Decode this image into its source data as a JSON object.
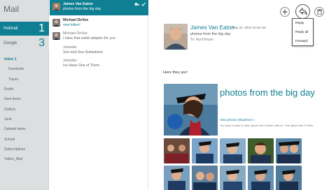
{
  "app": {
    "title": "Mail"
  },
  "accounts": [
    {
      "name": "Hotmail",
      "count": "1",
      "selected": true
    },
    {
      "name": "Google",
      "count": "3",
      "selected": false
    }
  ],
  "folders": [
    {
      "label": "Inbox 1",
      "active": true,
      "sub": false
    },
    {
      "label": "Facebook",
      "active": false,
      "sub": true
    },
    {
      "label": "Travel",
      "active": false,
      "sub": true
    },
    {
      "label": "Drafts",
      "active": false,
      "sub": false
    },
    {
      "label": "Sent items",
      "active": false,
      "sub": false
    },
    {
      "label": "Outbox",
      "active": false,
      "sub": false
    },
    {
      "label": "Junk",
      "active": false,
      "sub": false
    },
    {
      "label": "Deleted items",
      "active": false,
      "sub": false
    },
    {
      "label": "School",
      "active": false,
      "sub": false
    },
    {
      "label": "Subscriptions",
      "active": false,
      "sub": false
    },
    {
      "label": "Yahoo_Mail",
      "active": false,
      "sub": false
    }
  ],
  "messages": [
    {
      "from": "James Van Eaton",
      "subject": "photos from the big day",
      "selected": true,
      "new": false,
      "avatar": "#8a6a52"
    },
    {
      "from": "Michael DeVoe",
      "subject": "new kitten!",
      "selected": false,
      "new": true,
      "avatar": "#6d6d6d"
    },
    {
      "from": "Michael DeVoe",
      "subject": "I have that outlet adapter for you",
      "selected": false,
      "new": false,
      "avatar": "#6d6d6d"
    },
    {
      "from": "Jetsetter",
      "subject": "Sun and Sea Subsations",
      "selected": false,
      "new": false,
      "avatar": null
    },
    {
      "from": "Jetsetter",
      "subject": "Ice Have One of Them",
      "selected": false,
      "new": false,
      "avatar": null
    }
  ],
  "reading": {
    "sender": "James Van Eaton",
    "date": "May 22, 2012 10:15 AM",
    "subject": "photos from the big day",
    "to": "To: April Meyer",
    "body": "Here they are!",
    "attachment_title": "photos from the big day",
    "attachment_link": "View photos (Skydrive) »",
    "attachment_desc": "You were invited to view James Van Eaton's album. This album has 15 files."
  },
  "appbar": {
    "new_icon": "plus-icon",
    "respond_icon": "respond-icon",
    "delete_icon": "trash-icon"
  },
  "respond_menu": [
    "Reply",
    "Reply all",
    "Forward"
  ],
  "colors": {
    "accent": "#0f7f93",
    "folder_pane": "#dcdfe0"
  }
}
